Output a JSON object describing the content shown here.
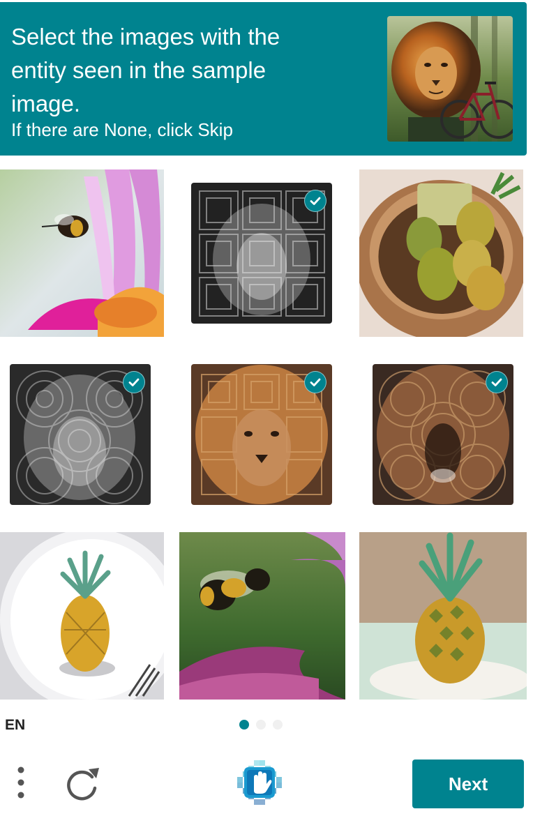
{
  "header": {
    "prompt": "Select the images with the entity seen in the sample image.",
    "subprompt": "If there are None, click Skip",
    "sample_image": "lion-with-bicycle"
  },
  "tiles": [
    {
      "image": "bee-on-pink-flower",
      "selected": false
    },
    {
      "image": "lion-grayscale-square-pattern",
      "selected": true
    },
    {
      "image": "pineapples-in-basket",
      "selected": false
    },
    {
      "image": "lion-grayscale-circle-pattern",
      "selected": true
    },
    {
      "image": "lion-color-square-pattern",
      "selected": true
    },
    {
      "image": "lion-roaring-circle-pattern",
      "selected": true
    },
    {
      "image": "pineapple-on-white-plate",
      "selected": false
    },
    {
      "image": "bee-flying-near-petals",
      "selected": false
    },
    {
      "image": "pineapple-on-plate-closeup",
      "selected": false
    }
  ],
  "footer": {
    "language": "EN",
    "pages": {
      "current": 1,
      "total": 3
    },
    "next_label": "Next"
  },
  "colors": {
    "accent": "#00838f",
    "inactive_dot": "#f0f0f0"
  }
}
